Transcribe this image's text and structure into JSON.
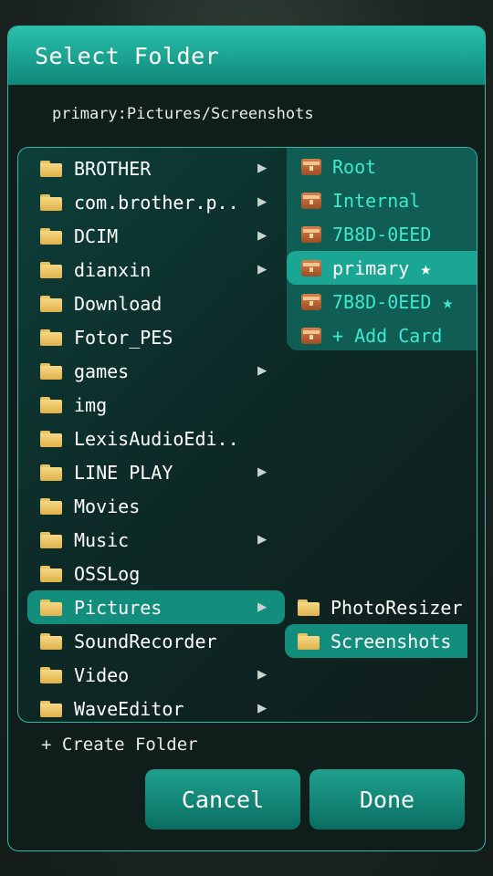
{
  "dialog": {
    "title": "Select Folder",
    "path": "primary:Pictures/Screenshots",
    "create_folder": "+ Create Folder",
    "cancel": "Cancel",
    "done": "Done"
  },
  "folders": [
    {
      "label": "BROTHER",
      "has_children": true
    },
    {
      "label": "com.brother.p..",
      "has_children": true
    },
    {
      "label": "DCIM",
      "has_children": true
    },
    {
      "label": "dianxin",
      "has_children": true
    },
    {
      "label": "Download",
      "has_children": false
    },
    {
      "label": "Fotor_PES",
      "has_children": false
    },
    {
      "label": "games",
      "has_children": true
    },
    {
      "label": "img",
      "has_children": false
    },
    {
      "label": "LexisAudioEdi..",
      "has_children": false
    },
    {
      "label": "LINE PLAY",
      "has_children": true
    },
    {
      "label": "Movies",
      "has_children": false
    },
    {
      "label": "Music",
      "has_children": true
    },
    {
      "label": "OSSLog",
      "has_children": false
    },
    {
      "label": "Pictures",
      "has_children": true,
      "selected": true
    },
    {
      "label": "SoundRecorder",
      "has_children": false
    },
    {
      "label": "Video",
      "has_children": true
    },
    {
      "label": "WaveEditor",
      "has_children": true
    }
  ],
  "storages": [
    {
      "label": "Root"
    },
    {
      "label": "Internal"
    },
    {
      "label": "7B8D-0EED"
    },
    {
      "label": "primary ★",
      "selected": true
    },
    {
      "label": "7B8D-0EED ★"
    },
    {
      "label": "+ Add Card"
    }
  ],
  "subfolders": [
    {
      "label": "PhotoResizer"
    },
    {
      "label": "Screenshots",
      "selected": true
    }
  ],
  "icons": {
    "arrow": "▶",
    "folder": "folder-icon",
    "storage": "storage-card-icon"
  },
  "colors": {
    "accent": "#1aa693",
    "storage_text": "#3ee8cf",
    "folder": "#f0cc70"
  }
}
